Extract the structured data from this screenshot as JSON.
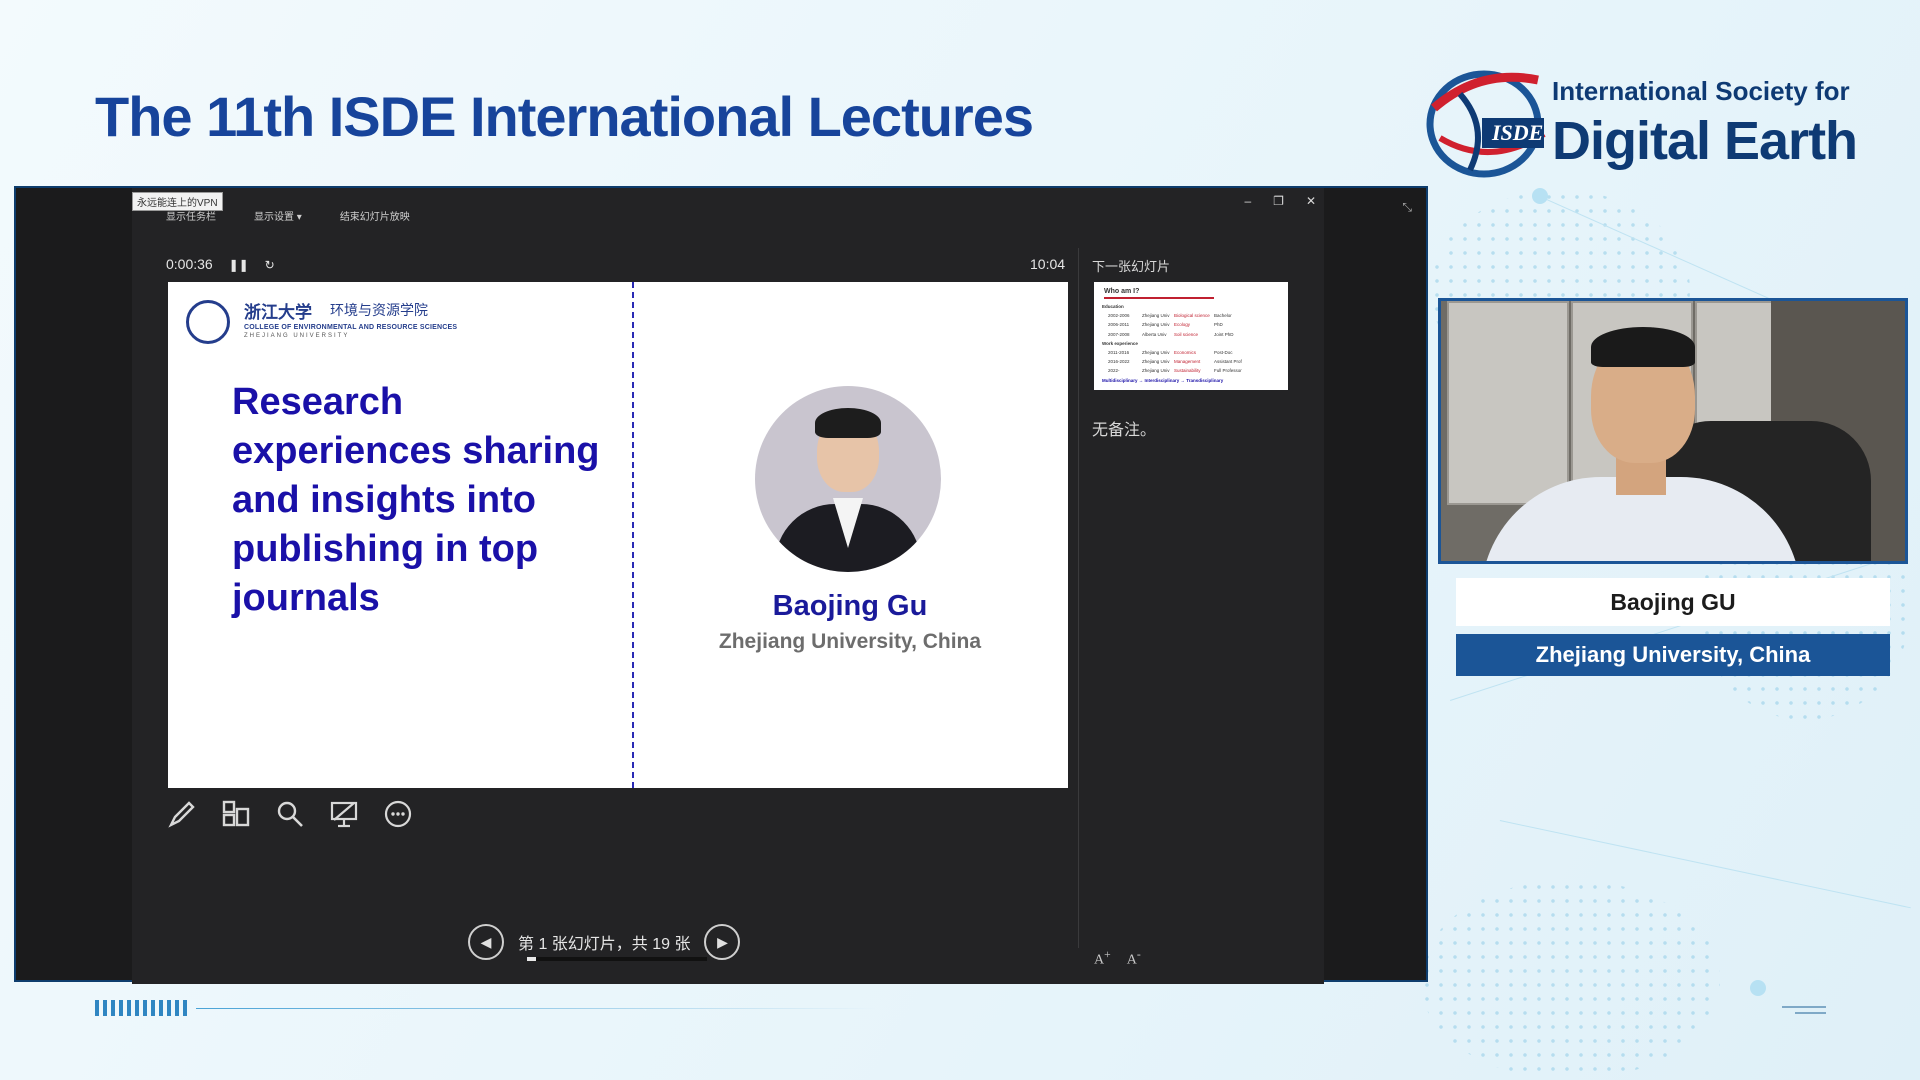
{
  "header": {
    "title": "The 11th ISDE International Lectures",
    "logo": {
      "line1": "International Society for",
      "line2": "Digital Earth",
      "abbr": "ISDE",
      "colors": {
        "navy": "#0e3a74",
        "red": "#d0202e",
        "blue": "#1b5597"
      }
    }
  },
  "presenter": {
    "vpn_badge": "永远能连上的VPN",
    "toolbar": {
      "show_taskbar": "显示任务栏",
      "display_settings": "显示设置 ▾",
      "end_slideshow": "结束幻灯片放映"
    },
    "elapsed_time": "0:00:36",
    "clock": "10:04",
    "next_slide_label": "下一张幻灯片",
    "notes_text": "无备注。",
    "slide_counter": "第 1 张幻灯片，共 19 张",
    "progress_fraction": 0.05,
    "tools": [
      "pen-icon",
      "see-all-slides-icon",
      "zoom-icon",
      "black-screen-icon",
      "more-options-icon"
    ]
  },
  "slide": {
    "university_cn": "浙江大学",
    "college_cn": "环境与资源学院",
    "college_en": "COLLEGE OF ENVIRONMENTAL AND RESOURCE SCIENCES",
    "university_en": "ZHEJIANG  UNIVERSITY",
    "title": "Research experiences sharing and insights into publishing in top journals",
    "speaker_name": "Baojing Gu",
    "speaker_affiliation": "Zhejiang University, China"
  },
  "next_slide": {
    "title": "Who am I?",
    "rows": [
      [
        "Education"
      ],
      [
        "2002-2006",
        "Zhejiang Univ",
        "Biological science",
        "Bachelor"
      ],
      [
        "2006-2011",
        "Zhejiang Univ",
        "Ecology",
        "PhD"
      ],
      [
        "2007-2008",
        "Alberta Univ",
        "Soil science",
        "Joint PhD"
      ],
      [
        "Work experience"
      ],
      [
        "2011-2016",
        "Zhejiang Univ",
        "Economics",
        "Post-Doc"
      ],
      [
        "2016-2022",
        "Zhejiang Univ",
        "Management",
        "Assistant Prof"
      ],
      [
        "2022-",
        "Zhejiang Univ",
        "Sustainability",
        "Full Professor"
      ],
      [
        "Multidisciplinary → Interdisciplinary → Transdisciplinary"
      ]
    ]
  },
  "speaker_card": {
    "name": "Baojing GU",
    "affiliation": "Zhejiang University, China"
  }
}
